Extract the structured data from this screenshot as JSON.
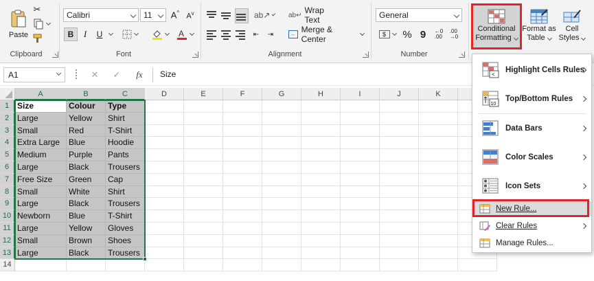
{
  "ribbon": {
    "clipboard": {
      "paste_label": "Paste",
      "group_label": "Clipboard"
    },
    "font": {
      "name": "Calibri",
      "size": "11",
      "bold": "B",
      "italic": "I",
      "underline": "U",
      "group_label": "Font",
      "highlight_color": "#f5e100",
      "font_color": "#e0242b"
    },
    "alignment": {
      "wrap_text": "Wrap Text",
      "merge_center": "Merge & Center",
      "group_label": "Alignment"
    },
    "number": {
      "format": "General",
      "currency": "$",
      "percent": "%",
      "comma": "9",
      "group_label": "Number"
    },
    "styles": {
      "conditional_formatting_1": "Conditional",
      "conditional_formatting_2": "Formatting",
      "format_as_table_1": "Format as",
      "format_as_table_2": "Table",
      "cell_styles_1": "Cell",
      "cell_styles_2": "Styles"
    }
  },
  "formula_bar": {
    "name_box": "A1",
    "cancel": "✕",
    "enter": "✓",
    "fx": "fx",
    "value": "Size"
  },
  "grid": {
    "columns": [
      "A",
      "B",
      "C",
      "D",
      "E",
      "F",
      "G",
      "H",
      "I",
      "J",
      "K",
      "L"
    ],
    "row_numbers": [
      "1",
      "2",
      "3",
      "4",
      "5",
      "6",
      "7",
      "8",
      "9",
      "10",
      "11",
      "12",
      "13",
      "14"
    ],
    "rows": [
      [
        "Size",
        "Colour",
        "Type"
      ],
      [
        "Large",
        "Yellow",
        "Shirt"
      ],
      [
        "Small",
        "Red",
        "T-Shirt"
      ],
      [
        "Extra Large",
        "Blue",
        "Hoodie"
      ],
      [
        "Medium",
        "Purple",
        "Pants"
      ],
      [
        "Large",
        "Black",
        "Trousers"
      ],
      [
        "Free Size",
        "Green",
        "Cap"
      ],
      [
        "Small",
        "White",
        "Shirt"
      ],
      [
        "Large",
        "Black",
        "Trousers"
      ],
      [
        "Newborn",
        "Blue",
        "T-Shirt"
      ],
      [
        "Large",
        "Yellow",
        "Gloves"
      ],
      [
        "Small",
        "Brown",
        "Shoes"
      ],
      [
        "Large",
        "Black",
        "Trousers"
      ]
    ]
  },
  "menu": {
    "highlight_cells_rules": "Highlight Cells Rules",
    "top_bottom_rules": "Top/Bottom Rules",
    "data_bars": "Data Bars",
    "color_scales": "Color Scales",
    "icon_sets": "Icon Sets",
    "new_rule": "New Rule...",
    "clear_rules": "Clear Rules",
    "manage_rules": "Manage Rules..."
  },
  "colors": {
    "excel_green": "#217346",
    "highlight_red": "#e0242b",
    "selection_gray": "#c6c6c6"
  }
}
